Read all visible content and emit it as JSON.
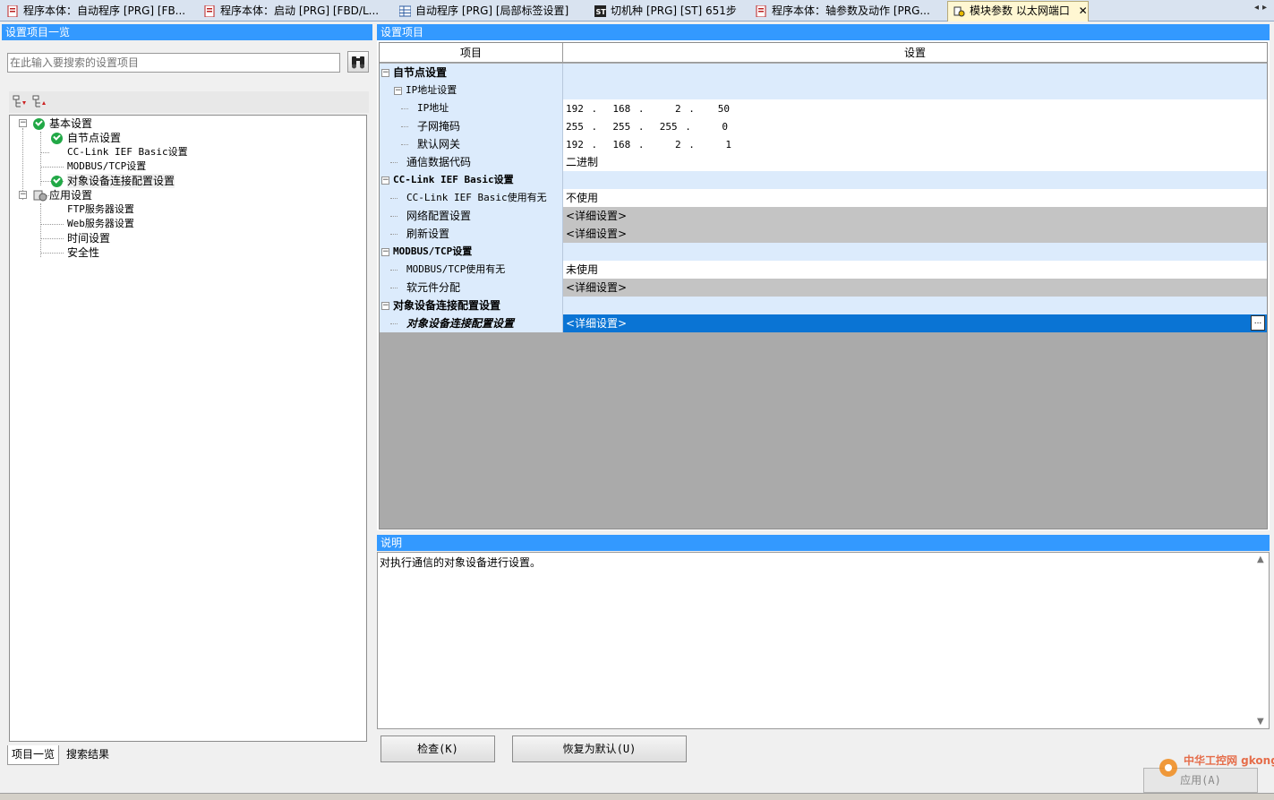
{
  "tabs": [
    {
      "label": "程序本体：自动程序 [PRG] [FB...",
      "icon": "program-icon"
    },
    {
      "label": "程序本体：启动 [PRG] [FBD/L...",
      "icon": "program-icon"
    },
    {
      "label": "自动程序 [PRG] [局部标签设置]",
      "icon": "label-table-icon"
    },
    {
      "label": "切机种 [PRG] [ST] 651步",
      "icon": "st-icon"
    },
    {
      "label": "程序本体：轴参数及动作 [PRG...",
      "icon": "program-icon"
    },
    {
      "label": "模块参数 以太网端口",
      "icon": "module-param-icon",
      "active": true
    }
  ],
  "left": {
    "title": "设置项目一览",
    "search_placeholder": "在此输入要搜索的设置项目",
    "tree": [
      {
        "label": "基本设置",
        "level": 0,
        "expander": "−",
        "icon": "check"
      },
      {
        "label": "自节点设置",
        "level": 1,
        "icon": "check"
      },
      {
        "label": "CC-Link IEF Basic设置",
        "level": 1
      },
      {
        "label": "MODBUS/TCP设置",
        "level": 1
      },
      {
        "label": "对象设备连接配置设置",
        "level": 1,
        "icon": "check"
      },
      {
        "label": "应用设置",
        "level": 0,
        "expander": "−",
        "icon": "app"
      },
      {
        "label": "FTP服务器设置",
        "level": 1
      },
      {
        "label": "Web服务器设置",
        "level": 1
      },
      {
        "label": "时间设置",
        "level": 1
      },
      {
        "label": "安全性",
        "level": 1
      }
    ],
    "bottom_tabs": [
      "项目一览",
      "搜索结果"
    ]
  },
  "right": {
    "title": "设置项目",
    "col_item": "项目",
    "col_setting": "设置",
    "rows": [
      {
        "key": "自节点设置",
        "indent": 0,
        "expander": "−",
        "bold": true,
        "value": "",
        "vstyle": "blue"
      },
      {
        "key": "IP地址设置",
        "indent": 1,
        "expander": "−",
        "value": "",
        "vstyle": "blue"
      },
      {
        "key": "IP地址",
        "indent": 2,
        "value": "192 .  168 .    2 .   50",
        "vstyle": "white",
        "ip": true
      },
      {
        "key": "子网掩码",
        "indent": 2,
        "value": "255 .  255 .  255 .    0",
        "vstyle": "white",
        "ip": true
      },
      {
        "key": "默认网关",
        "indent": 2,
        "value": "192 .  168 .    2 .    1",
        "vstyle": "white",
        "ip": true
      },
      {
        "key": "通信数据代码",
        "indent": 1,
        "value": "二进制",
        "vstyle": "white"
      },
      {
        "key": "CC-Link IEF Basic设置",
        "indent": 0,
        "expander": "−",
        "bold": true,
        "value": "",
        "vstyle": "blue"
      },
      {
        "key": "CC-Link IEF Basic使用有无",
        "indent": 1,
        "value": "不使用",
        "vstyle": "white"
      },
      {
        "key": "网络配置设置",
        "indent": 1,
        "value": "<详细设置>",
        "vstyle": "gray"
      },
      {
        "key": "刷新设置",
        "indent": 1,
        "value": "<详细设置>",
        "vstyle": "gray"
      },
      {
        "key": "MODBUS/TCP设置",
        "indent": 0,
        "expander": "−",
        "bold": true,
        "value": "",
        "vstyle": "blue"
      },
      {
        "key": "MODBUS/TCP使用有无",
        "indent": 1,
        "value": "未使用",
        "vstyle": "white"
      },
      {
        "key": "软元件分配",
        "indent": 1,
        "value": "<详细设置>",
        "vstyle": "gray"
      },
      {
        "key": "对象设备连接配置设置",
        "indent": 0,
        "expander": "−",
        "bold": true,
        "value": "",
        "vstyle": "blue"
      },
      {
        "key": "对象设备连接配置设置",
        "indent": 1,
        "value": "<详细设置>",
        "vstyle": "sel",
        "italic": true,
        "button": "..."
      }
    ]
  },
  "description": {
    "title": "说明",
    "text": "对执行通信的对象设备进行设置。"
  },
  "buttons": {
    "check": "检查(K)",
    "restore": "恢复为默认(U)",
    "apply": "应用(A)"
  },
  "watermark": "中华工控网 gkong.com"
}
